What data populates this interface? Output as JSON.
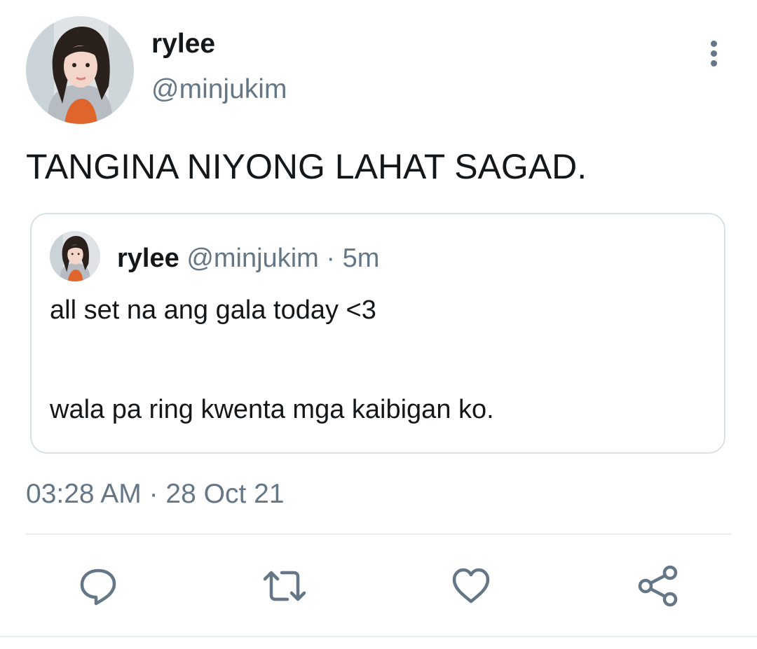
{
  "tweet": {
    "author": {
      "display_name": "rylee",
      "handle": "@minjukim",
      "avatar_icon": "profile-photo"
    },
    "text": "TANGINA NIYONG LAHAT SAGAD.",
    "more_icon": "more-vertical-icon",
    "quoted": {
      "display_name": "rylee",
      "handle": "@minjukim",
      "separator": "·",
      "time": "5m",
      "line1": "all set na ang gala today <3",
      "line2": "wala pa ring kwenta mga kaibigan ko."
    },
    "timestamp": "03:28 AM · 28 Oct 21"
  },
  "actions": [
    {
      "icon": "reply-icon"
    },
    {
      "icon": "retweet-icon"
    },
    {
      "icon": "like-icon"
    },
    {
      "icon": "share-icon"
    }
  ],
  "colors": {
    "text_primary": "#14171a",
    "text_secondary": "#657786",
    "border": "#d9e1e8",
    "divider": "#e6ecf0"
  }
}
